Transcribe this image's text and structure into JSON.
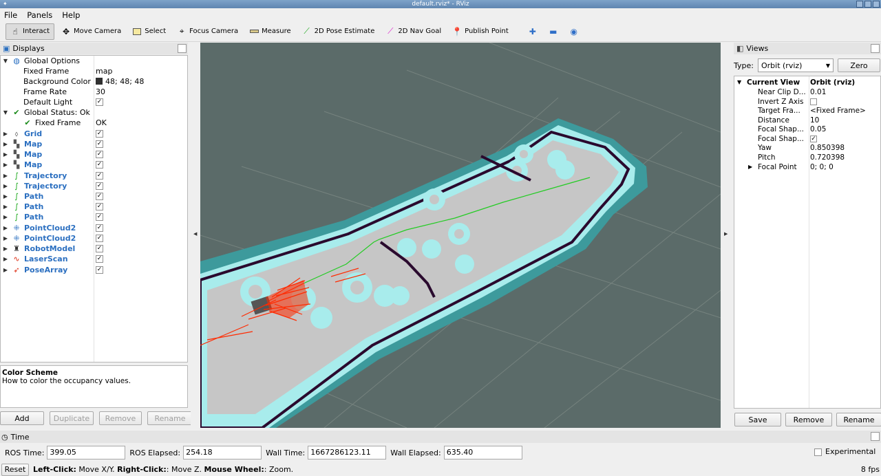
{
  "window": {
    "title": "default.rviz* - RViz"
  },
  "menu": {
    "file": "File",
    "panels": "Panels",
    "help": "Help"
  },
  "toolbar": {
    "interact": "Interact",
    "move_camera": "Move Camera",
    "select": "Select",
    "focus_camera": "Focus Camera",
    "measure": "Measure",
    "pose_estimate": "2D Pose Estimate",
    "nav_goal": "2D Nav Goal",
    "publish_point": "Publish Point"
  },
  "displays": {
    "header": "Displays",
    "global_options": "Global Options",
    "fixed_frame_label": "Fixed Frame",
    "fixed_frame_value": "map",
    "bg_color_label": "Background Color",
    "bg_color_value": "48; 48; 48",
    "frame_rate_label": "Frame Rate",
    "frame_rate_value": "30",
    "default_light_label": "Default Light",
    "global_status": "Global Status: Ok",
    "gs_fixed_frame": "Fixed Frame",
    "gs_fixed_frame_value": "OK",
    "items": [
      {
        "label": "Grid",
        "icon": "grid-icon"
      },
      {
        "label": "Map",
        "icon": "map-icon"
      },
      {
        "label": "Map",
        "icon": "map-icon"
      },
      {
        "label": "Map",
        "icon": "map-icon"
      },
      {
        "label": "Trajectory",
        "icon": "trajectory-icon"
      },
      {
        "label": "Trajectory",
        "icon": "trajectory-icon"
      },
      {
        "label": "Path",
        "icon": "path-icon"
      },
      {
        "label": "Path",
        "icon": "path-icon"
      },
      {
        "label": "Path",
        "icon": "path-icon"
      },
      {
        "label": "PointCloud2",
        "icon": "pointcloud-icon"
      },
      {
        "label": "PointCloud2",
        "icon": "pointcloud-icon"
      },
      {
        "label": "RobotModel",
        "icon": "robot-icon"
      },
      {
        "label": "LaserScan",
        "icon": "laserscan-icon"
      },
      {
        "label": "PoseArray",
        "icon": "posearray-icon"
      }
    ],
    "desc_title": "Color Scheme",
    "desc_text": "How to color the occupancy values.",
    "add": "Add",
    "duplicate": "Duplicate",
    "remove": "Remove",
    "rename": "Rename"
  },
  "views": {
    "header": "Views",
    "type_label": "Type:",
    "type_value": "Orbit (rviz)",
    "zero": "Zero",
    "current_view": "Current View",
    "current_view_value": "Orbit (rviz)",
    "props": [
      {
        "label": "Near Clip D...",
        "value": "0.01"
      },
      {
        "label": "Invert Z Axis",
        "value": ""
      },
      {
        "label": "Target Fra...",
        "value": "<Fixed Frame>"
      },
      {
        "label": "Distance",
        "value": "10"
      },
      {
        "label": "Focal Shap...",
        "value": "0.05"
      },
      {
        "label": "Focal Shap...",
        "value": ""
      },
      {
        "label": "Yaw",
        "value": "0.850398"
      },
      {
        "label": "Pitch",
        "value": "0.720398"
      },
      {
        "label": "Focal Point",
        "value": "0; 0; 0"
      }
    ],
    "save": "Save",
    "remove": "Remove",
    "rename": "Rename"
  },
  "time": {
    "header": "Time",
    "ros_time_label": "ROS Time:",
    "ros_time": "399.05",
    "ros_elapsed_label": "ROS Elapsed:",
    "ros_elapsed": "254.18",
    "wall_time_label": "Wall Time:",
    "wall_time": "1667286123.11",
    "wall_elapsed_label": "Wall Elapsed:",
    "wall_elapsed": "635.40",
    "experimental": "Experimental"
  },
  "status": {
    "reset": "Reset",
    "left_click": "Left-Click:",
    "left_click_text": " Move X/Y. ",
    "right_click": "Right-Click:",
    "right_click_text": ": Move Z. ",
    "wheel": "Mouse Wheel:",
    "wheel_text": ": Zoom.",
    "fps": "8 fps"
  },
  "colors": {
    "viewport_bg": "#5b6b69",
    "map_floor": "#c6c6c6",
    "inflation": "#a8ecec",
    "cost_outer": "#3d9a9c",
    "wall": "#2a0a2e",
    "trajectory": "#22cc22",
    "laser": "#ff2a00",
    "accent_blue": "#2b6fc0"
  }
}
